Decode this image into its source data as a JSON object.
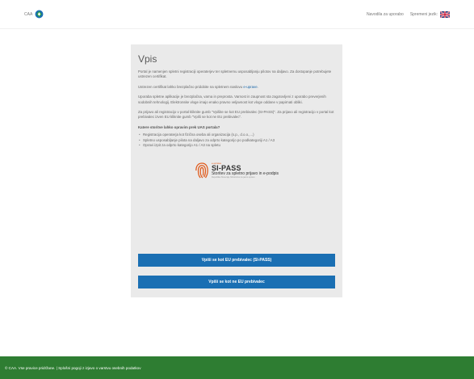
{
  "header": {
    "brand_text": "CAA",
    "nav_instructions": "Navodila za uporabo",
    "nav_language": "Spremeni jezik:"
  },
  "main": {
    "title": "Vpis",
    "paragraphs": [
      "Portal je namenjen spletni registraciji operaterjev ter spletnemu usposabljanju pilotov na daljavo. Za dostopanje potrebujete ustrezen certifikat.",
      "Uporaba spletne aplikacije je brezplačna, varna in preprosta. Varnost in zaupnost sta zagotovljeni z uporabo preverjenih sodobnih tehnologij. Elektronske vloge imajo enako pravno veljavnost kot vloge oddane v papirnati obliki.",
      "Za prijavo ali registracijo v portal kliknite gumb \"Vpišite se kot EU prebivalec (SI-PASS)\". Za prijavo ali registracijo v portal kot prebivalec izven EU kliknite gumb \"Vpiši se kot ne EU prebivalec\"."
    ],
    "cert_text": "Ustrezen certifikat lahko brezplačno pridobite na spletnem naslovu ",
    "cert_link": "e-uprave",
    "cert_suffix": ".",
    "question": "Katere storitve lahko opravim prek UAS portala?",
    "services": [
      "Registracija operaterja kot fizična oseba ali organizacija (s.p., d.o.o.,...)",
      "Spletno usposabljanje pilota na daljavo za odprto kategorijo po podkategoriji A1 / A3",
      "Opravi izpit za odprto kategorijo A1 / A3 na spletu"
    ]
  },
  "sipass": {
    "small": "e-uprava",
    "name": "SI-PASS",
    "subtitle": "Storitev za spletno prijavo in e-podpis",
    "tiny": "Republika Slovenija, Ministrstvo za javno upravo"
  },
  "buttons": {
    "eu": "Vpiši se kot EU prebivalec (SI-PASS)",
    "non_eu": "Vpiši se kot ne EU prebivalec"
  },
  "footer": {
    "text": "© CAA. Vse pravice pridržane. | Splošni pogoji z izjavo o varstvu osebnih podatkov"
  },
  "colors": {
    "button": "#1a6fb3",
    "footer": "#2e7d32",
    "panel": "#eaeaea",
    "link": "#1565a8",
    "sipass_accent": "#e05a1b"
  }
}
